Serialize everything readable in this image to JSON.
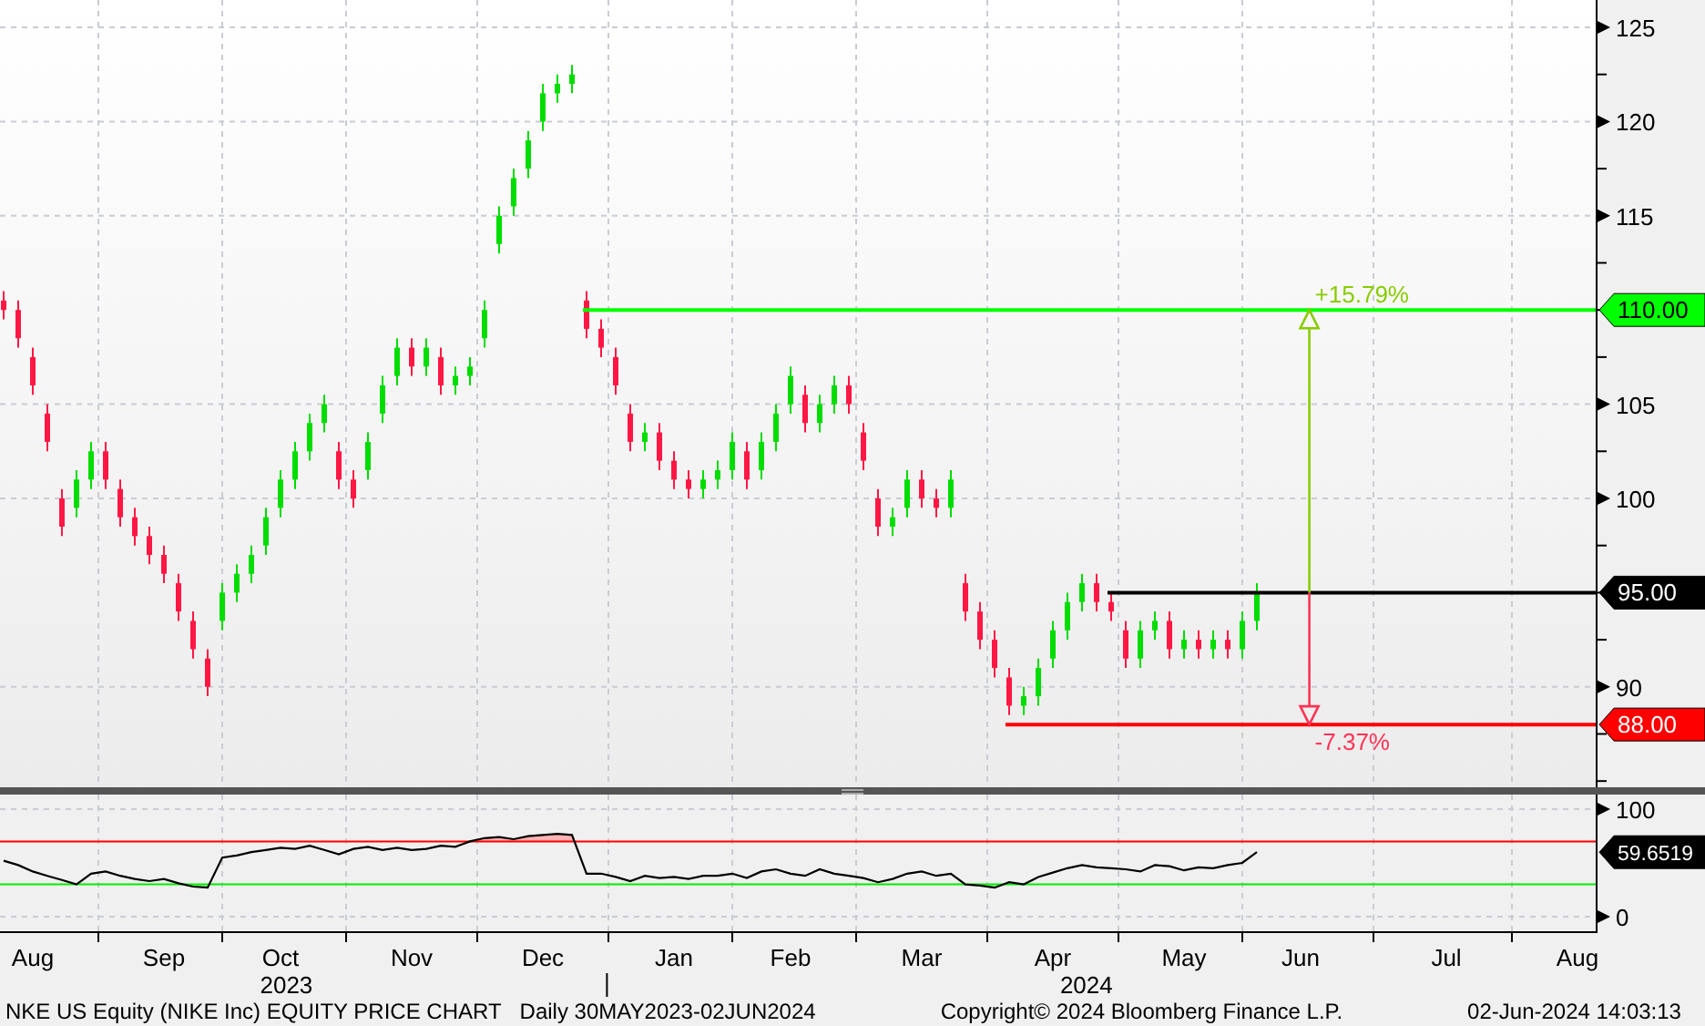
{
  "price_chart": {
    "chart_data": {
      "type": "candlestick",
      "categories": [
        null,
        null,
        null,
        null,
        null,
        null,
        null,
        null,
        null,
        null,
        null,
        null,
        null,
        null,
        null,
        null,
        null,
        null,
        null,
        null,
        null,
        null,
        null,
        null,
        null,
        null,
        null,
        null,
        null,
        null,
        null,
        null,
        null,
        null,
        null,
        null,
        null,
        null,
        null,
        null,
        null,
        null,
        null,
        null,
        null,
        null,
        null,
        null,
        null,
        null,
        null,
        null,
        null,
        null,
        null,
        null,
        null,
        null,
        null,
        null,
        null,
        null,
        null,
        null,
        null,
        null,
        null,
        null,
        null,
        null,
        null,
        null,
        null,
        null,
        null,
        null,
        null,
        null,
        null,
        null,
        null,
        null,
        null,
        null,
        null,
        null,
        null,
        null,
        null,
        null,
        null,
        null,
        null,
        null,
        null,
        null,
        null,
        null,
        null,
        null,
        null,
        null,
        null,
        null,
        null,
        null,
        null,
        null,
        null,
        null
      ],
      "ohlc": [
        [
          110.5,
          111,
          109.5,
          110
        ],
        [
          110,
          110.5,
          108,
          108.5
        ],
        [
          107.5,
          108,
          105.5,
          106
        ],
        [
          104.5,
          105,
          102.5,
          103
        ],
        [
          100,
          100.5,
          98,
          98.5
        ],
        [
          99.5,
          101.5,
          99,
          101
        ],
        [
          101,
          103,
          100.5,
          102.5
        ],
        [
          102.5,
          103,
          100.5,
          101
        ],
        [
          100.5,
          101,
          98.5,
          99
        ],
        [
          99,
          99.5,
          97.5,
          98
        ],
        [
          98,
          98.5,
          96.5,
          97
        ],
        [
          97,
          97.5,
          95.5,
          96
        ],
        [
          95.5,
          96,
          93.5,
          94
        ],
        [
          93.5,
          94,
          91.5,
          92
        ],
        [
          91.5,
          92,
          89.5,
          90
        ],
        [
          93.5,
          95.5,
          93,
          95
        ],
        [
          95,
          96.5,
          94.5,
          96
        ],
        [
          96,
          97.5,
          95.5,
          97
        ],
        [
          97.5,
          99.5,
          97,
          99
        ],
        [
          99.5,
          101.5,
          99,
          101
        ],
        [
          101,
          103,
          100.5,
          102.5
        ],
        [
          102.5,
          104.5,
          102,
          104
        ],
        [
          104,
          105.5,
          103.5,
          105
        ],
        [
          102.5,
          103,
          100.5,
          101
        ],
        [
          101,
          101.5,
          99.5,
          100
        ],
        [
          101.5,
          103.5,
          101,
          103
        ],
        [
          104.5,
          106.5,
          104,
          106
        ],
        [
          106.5,
          108.5,
          106,
          108
        ],
        [
          108,
          108.5,
          106.5,
          107
        ],
        [
          107,
          108.5,
          106.5,
          108
        ],
        [
          107.5,
          108,
          105.5,
          106
        ],
        [
          106,
          107,
          105.5,
          106.5
        ],
        [
          106.5,
          107.5,
          106,
          107
        ],
        [
          108.5,
          110.5,
          108,
          110
        ],
        [
          113.5,
          115.5,
          113,
          115
        ],
        [
          115.5,
          117.5,
          115,
          117
        ],
        [
          117.5,
          119.5,
          117,
          119
        ],
        [
          120,
          122,
          119.5,
          121.5
        ],
        [
          121.5,
          122.5,
          121,
          122
        ],
        [
          122,
          123,
          121.5,
          122.5
        ],
        [
          110.5,
          111,
          108.5,
          109
        ],
        [
          109,
          109.5,
          107.5,
          108
        ],
        [
          107.5,
          108,
          105.5,
          106
        ],
        [
          104.5,
          105,
          102.5,
          103
        ],
        [
          103,
          104,
          102.5,
          103.5
        ],
        [
          103.5,
          104,
          101.5,
          102
        ],
        [
          102,
          102.5,
          100.5,
          101
        ],
        [
          101,
          101.5,
          100,
          100.5
        ],
        [
          100.5,
          101.5,
          100,
          101
        ],
        [
          101,
          102,
          100.5,
          101.5
        ],
        [
          101.5,
          103.5,
          101,
          103
        ],
        [
          102.5,
          103,
          100.5,
          101
        ],
        [
          101.5,
          103.5,
          101,
          103
        ],
        [
          103,
          105,
          102.5,
          104.5
        ],
        [
          105,
          107,
          104.5,
          106.5
        ],
        [
          105.5,
          106,
          103.5,
          104
        ],
        [
          104,
          105.5,
          103.5,
          105
        ],
        [
          105,
          106.5,
          104.5,
          106
        ],
        [
          106,
          106.5,
          104.5,
          105
        ],
        [
          103.5,
          104,
          101.5,
          102
        ],
        [
          100,
          100.5,
          98,
          98.5
        ],
        [
          98.5,
          99.5,
          98,
          99
        ],
        [
          99.5,
          101.5,
          99,
          101
        ],
        [
          101,
          101.5,
          99.5,
          100
        ],
        [
          100,
          100.5,
          99,
          99.5
        ],
        [
          99.5,
          101.5,
          99,
          101
        ],
        [
          95.5,
          96,
          93.5,
          94
        ],
        [
          94,
          94.5,
          92,
          92.5
        ],
        [
          92.5,
          93,
          90.5,
          91
        ],
        [
          90.5,
          91,
          88.5,
          89
        ],
        [
          89,
          90,
          88.5,
          89.5
        ],
        [
          89.5,
          91.5,
          89,
          91
        ],
        [
          91.5,
          93.5,
          91,
          93
        ],
        [
          93,
          95,
          92.5,
          94.5
        ],
        [
          94.5,
          96,
          94,
          95.5
        ],
        [
          95.5,
          96,
          94,
          94.5
        ],
        [
          94.5,
          95,
          93.5,
          94
        ],
        [
          93,
          93.5,
          91,
          91.5
        ],
        [
          91.5,
          93.5,
          91,
          93
        ],
        [
          93,
          94,
          92.5,
          93.5
        ],
        [
          93.5,
          94,
          91.5,
          92
        ],
        [
          92,
          93,
          91.5,
          92.5
        ],
        [
          92.5,
          93,
          91.5,
          92
        ],
        [
          92,
          93,
          91.5,
          92.5
        ],
        [
          92.5,
          93,
          91.5,
          92
        ],
        [
          92,
          94,
          91.5,
          93.5
        ],
        [
          93.5,
          95.5,
          93,
          95
        ],
        null,
        null,
        null,
        null,
        null,
        null,
        null,
        null,
        null,
        null,
        null,
        null,
        null,
        null,
        null,
        null,
        null,
        null,
        null,
        null,
        null,
        null,
        null
      ],
      "ylim": [
        84.67,
        126.45
      ],
      "yticks": [
        90,
        100,
        105,
        115,
        120,
        125
      ],
      "grid": true,
      "ref_lines": [
        {
          "axis": "y",
          "value": 110,
          "label": "110.00",
          "color": "#00ff00"
        },
        {
          "axis": "y",
          "value": 95,
          "label": "95.00",
          "color": "#000000"
        },
        {
          "axis": "y",
          "value": 88,
          "label": "88.00",
          "color": "#ff0000"
        }
      ],
      "annotations": [
        "+15.79%",
        "-7.37%"
      ]
    }
  },
  "rsi_chart": {
    "chart_data": {
      "type": "line",
      "categories": [
        null,
        null,
        "Aug",
        null,
        null,
        null,
        null,
        null,
        null,
        null,
        null,
        "Sep",
        null,
        null,
        null,
        null,
        null,
        null,
        null,
        "Oct",
        null,
        null,
        null,
        null,
        null,
        null,
        null,
        null,
        "Nov",
        null,
        null,
        null,
        null,
        null,
        null,
        null,
        null,
        "Dec",
        null,
        null,
        null,
        null,
        null,
        null,
        null,
        null,
        "Jan",
        null,
        null,
        null,
        null,
        null,
        null,
        null,
        "Feb",
        null,
        null,
        null,
        null,
        null,
        null,
        null,
        null,
        "Mar",
        null,
        null,
        null,
        null,
        null,
        null,
        null,
        null,
        "Apr",
        null,
        null,
        null,
        null,
        null,
        null,
        null,
        null,
        "May",
        null,
        null,
        null,
        null,
        null,
        null,
        null,
        "Jun",
        null,
        null,
        null,
        null,
        null,
        null,
        null,
        null,
        null,
        "Jul",
        null,
        null,
        null,
        null,
        null,
        null,
        null,
        null,
        "Aug",
        null
      ],
      "series": [
        {
          "color": "#000000",
          "values": [
            52,
            48,
            42,
            38,
            34,
            30,
            40,
            42,
            38,
            35,
            33,
            35,
            31,
            28,
            27,
            55,
            57,
            60,
            62,
            64,
            63,
            66,
            62,
            58,
            63,
            65,
            62,
            64,
            62,
            63,
            66,
            65,
            70,
            73,
            74,
            72,
            75,
            76,
            77,
            76,
            40,
            40,
            37,
            33,
            38,
            36,
            37,
            35,
            38,
            38,
            40,
            36,
            42,
            44,
            40,
            38,
            44,
            40,
            38,
            36,
            32,
            35,
            40,
            42,
            38,
            40,
            30,
            29,
            27,
            32,
            30,
            37,
            41,
            45,
            48,
            46,
            45,
            44,
            42,
            48,
            47,
            43,
            46,
            45,
            48,
            50,
            60,
            null,
            null,
            null,
            null,
            null,
            null,
            null,
            null,
            null,
            null,
            null,
            null,
            null,
            null,
            null,
            null,
            null,
            null,
            null,
            null,
            null,
            null,
            null
          ]
        }
      ],
      "ylim": [
        -15.3,
        113.6
      ],
      "yticks": [
        0,
        100
      ],
      "grid": true,
      "ref_lines": [
        {
          "axis": "y",
          "value": 70,
          "color": "#ff0000"
        },
        {
          "axis": "y",
          "value": 30,
          "color": "#00ee00"
        }
      ]
    },
    "last_value": "59.6519",
    "year_labels": [
      "2023",
      "2024"
    ]
  },
  "footer": {
    "title": "NKE US Equity (NIKE Inc) EQUITY PRICE CHART",
    "period": "Daily 30MAY2023-02JUN2024",
    "copyright": "Copyright© 2024 Bloomberg Finance L.P.",
    "timestamp": "02-Jun-2024 14:03:13"
  }
}
